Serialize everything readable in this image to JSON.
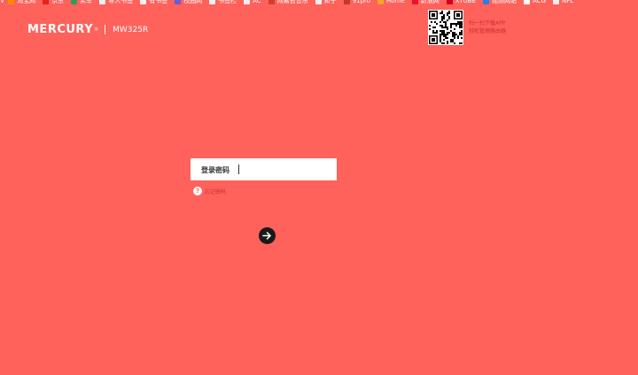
{
  "bookmarks": [
    {
      "label": "淘宝网",
      "icon": "taobao-icon",
      "color": "#ff8a00"
    },
    {
      "label": "京东",
      "icon": "jd-icon",
      "color": "#e1251b"
    },
    {
      "label": "买车",
      "icon": "car-icon",
      "color": "#2e9c5a"
    },
    {
      "label": "导入书签",
      "icon": "folder-icon",
      "color": "#f0f0f0"
    },
    {
      "label": "有书签",
      "icon": "folder-icon",
      "color": "#f0f0f0"
    },
    {
      "label": "校园网",
      "icon": "campus-icon",
      "color": "#6b5bd6"
    },
    {
      "label": "书签栏",
      "icon": "folder-icon",
      "color": "#f0f0f0"
    },
    {
      "label": "AC",
      "icon": "folder-icon",
      "color": "#f0f0f0"
    },
    {
      "label": "网易云音乐",
      "icon": "netease-icon",
      "color": "#d43c33"
    },
    {
      "label": "知乎",
      "icon": "folder-icon",
      "color": "#f0f0f0"
    },
    {
      "label": "91pro",
      "icon": "pro-icon",
      "color": "#c0392b"
    },
    {
      "label": "Home",
      "icon": "home-icon",
      "color": "#f5a623"
    },
    {
      "label": "新浪网",
      "icon": "sina-icon",
      "color": "#e6162d"
    },
    {
      "label": "XTUBE",
      "icon": "x-icon",
      "color": "#d0021b"
    },
    {
      "label": "视频网站",
      "icon": "video-icon",
      "color": "#2b7de9"
    },
    {
      "label": "ACG",
      "icon": "dots-icon",
      "color": "#ffffff"
    },
    {
      "label": "NFL",
      "icon": "folder-icon",
      "color": "#f0f0f0"
    }
  ],
  "brand": {
    "name": "MERCURY",
    "tm": "®",
    "model": "MW325R"
  },
  "qr": {
    "line1": "扫一扫下载APP",
    "line2": "轻松管理路由器"
  },
  "login": {
    "label": "登录密码",
    "value": "",
    "forgot": "忘记密码"
  },
  "colors": {
    "background": "#ff615b",
    "accent": "#c8322c",
    "button": "#1a1a1a"
  }
}
